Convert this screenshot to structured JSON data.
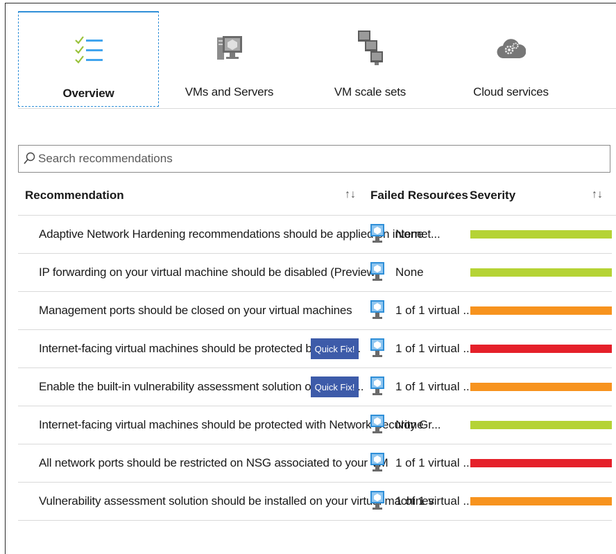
{
  "tabs": [
    {
      "label": "Overview",
      "icon": "checklist-icon",
      "active": true
    },
    {
      "label": "VMs and Servers",
      "icon": "server-icon",
      "active": false
    },
    {
      "label": "VM scale sets",
      "icon": "scale-set-icon",
      "active": false
    },
    {
      "label": "Cloud services",
      "icon": "cloud-gear-icon",
      "active": false
    }
  ],
  "search": {
    "placeholder": "Search recommendations",
    "value": ""
  },
  "table": {
    "columns": [
      "Recommendation",
      "Failed Resources",
      "Severity"
    ],
    "sort_symbol": "↑↓",
    "quick_fix_label": "Quick Fix!",
    "rows": [
      {
        "recommendation": "Adaptive Network Hardening recommendations should be applied on internet...",
        "failed": "None",
        "severity": "low",
        "quick_fix": false
      },
      {
        "recommendation": "IP forwarding on your virtual machine should be disabled (Preview)",
        "failed": "None",
        "severity": "low",
        "quick_fix": false
      },
      {
        "recommendation": "Management ports should be closed on your virtual machines",
        "failed": "1 of 1 virtual ...",
        "severity": "medium",
        "quick_fix": false
      },
      {
        "recommendation": "Internet-facing virtual machines should be protected by just-in...",
        "failed": "1 of 1 virtual ...",
        "severity": "high",
        "quick_fix": true
      },
      {
        "recommendation": "Enable the built-in vulnerability assessment solution on virtual ...",
        "failed": "1 of 1 virtual ...",
        "severity": "medium",
        "quick_fix": true
      },
      {
        "recommendation": "Internet-facing virtual machines should be protected with Network Security Gr...",
        "failed": "None",
        "severity": "low",
        "quick_fix": false
      },
      {
        "recommendation": "All network ports should be restricted on NSG associated to your VM",
        "failed": "1 of 1 virtual ...",
        "severity": "high",
        "quick_fix": false
      },
      {
        "recommendation": "Vulnerability assessment solution should be installed on your virtual machines",
        "failed": "1 of 1 virtual ...",
        "severity": "medium",
        "quick_fix": false
      }
    ]
  },
  "colors": {
    "low": "#b5d335",
    "medium": "#f7931e",
    "high": "#e5202a",
    "accent": "#2f8fd8",
    "quick_fix": "#3d5ba9"
  }
}
